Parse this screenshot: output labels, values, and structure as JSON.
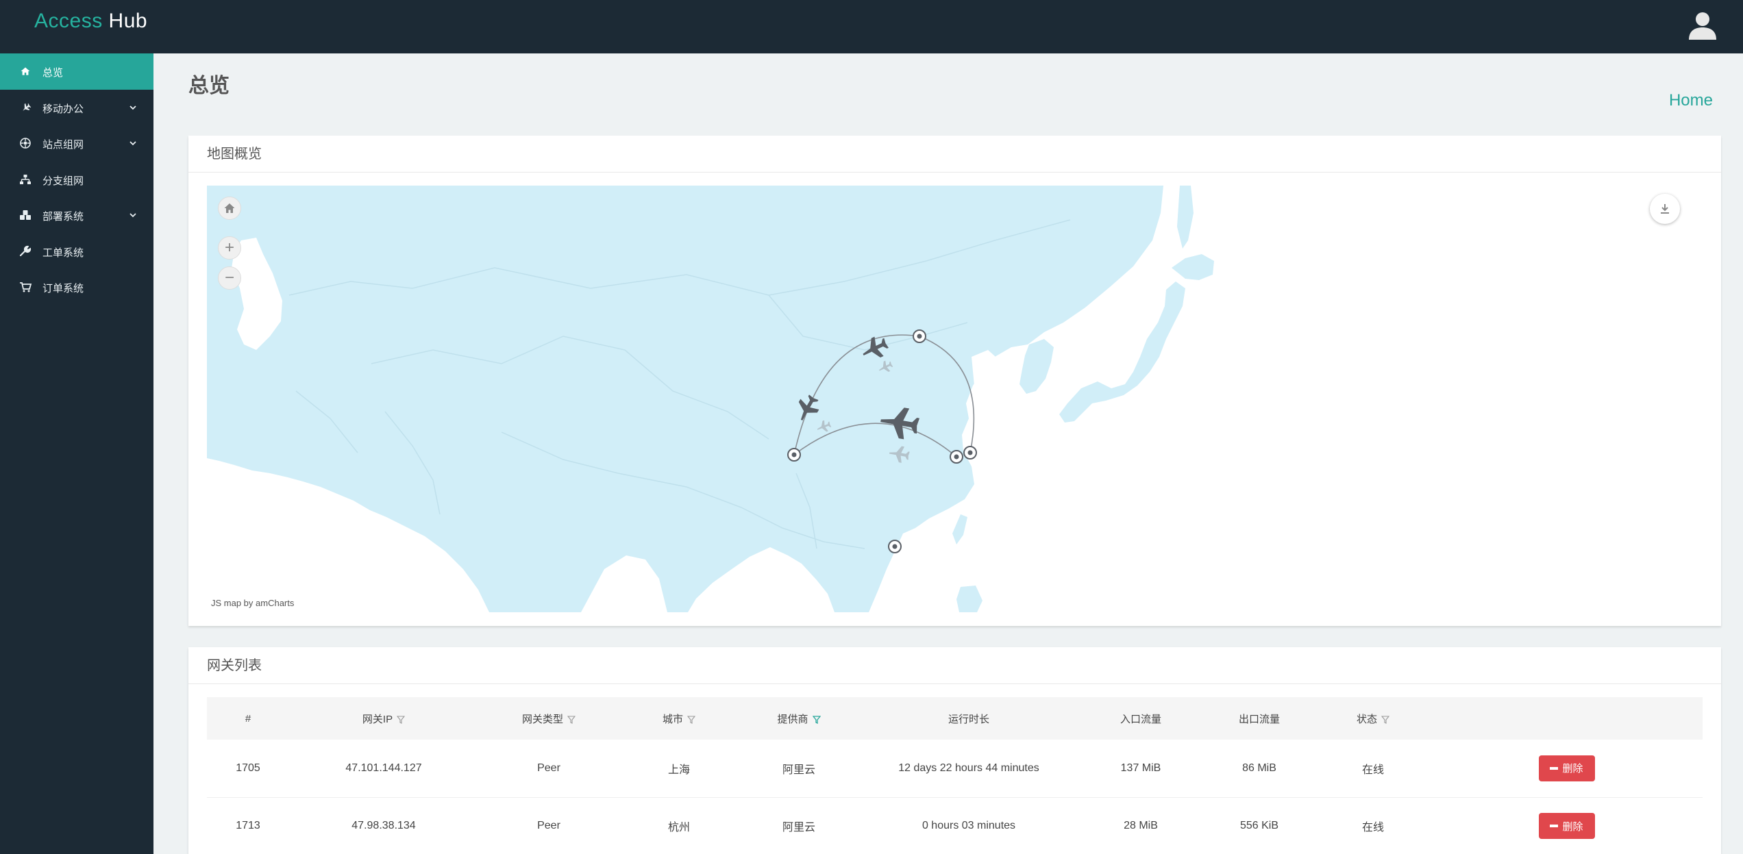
{
  "header": {
    "logo_part1": "Access",
    "logo_part2": " Hub"
  },
  "sidebar": {
    "items": [
      {
        "label": "总览",
        "icon": "home-icon",
        "active": true,
        "has_submenu": false
      },
      {
        "label": "移动办公",
        "icon": "plane-icon",
        "active": false,
        "has_submenu": true
      },
      {
        "label": "站点组网",
        "icon": "network-icon",
        "active": false,
        "has_submenu": true
      },
      {
        "label": "分支组网",
        "icon": "sitemap-icon",
        "active": false,
        "has_submenu": false
      },
      {
        "label": "部署系统",
        "icon": "cubes-icon",
        "active": false,
        "has_submenu": true
      },
      {
        "label": "工单系统",
        "icon": "wrench-icon",
        "active": false,
        "has_submenu": false
      },
      {
        "label": "订单系统",
        "icon": "cart-icon",
        "active": false,
        "has_submenu": false
      }
    ]
  },
  "page": {
    "title": "总览",
    "breadcrumb": "Home"
  },
  "map_card": {
    "title": "地图概览",
    "credit": "JS map by amCharts",
    "zoom_in": "+",
    "zoom_out": "−"
  },
  "gateway_card": {
    "title": "网关列表",
    "columns": [
      "#",
      "网关IP",
      "网关类型",
      "城市",
      "提供商",
      "运行时长",
      "入口流量",
      "出口流量",
      "状态",
      ""
    ],
    "rows": [
      {
        "id": "1705",
        "ip": "47.101.144.127",
        "type": "Peer",
        "city": "上海",
        "provider": "阿里云",
        "uptime": "12 days 22 hours 44 minutes",
        "ingress": "137 MiB",
        "egress": "86 MiB",
        "status": "在线",
        "action": "删除"
      },
      {
        "id": "1713",
        "ip": "47.98.38.134",
        "type": "Peer",
        "city": "杭州",
        "provider": "阿里云",
        "uptime": "0 hours 03 minutes",
        "ingress": "28 MiB",
        "egress": "556 KiB",
        "status": "在线",
        "action": "删除"
      }
    ]
  },
  "colors": {
    "accent": "#26a69a",
    "sidebar_bg": "#1c2a35",
    "danger": "#e0474c",
    "land": "#d1eef8",
    "border_line": "#bfe0ec"
  }
}
